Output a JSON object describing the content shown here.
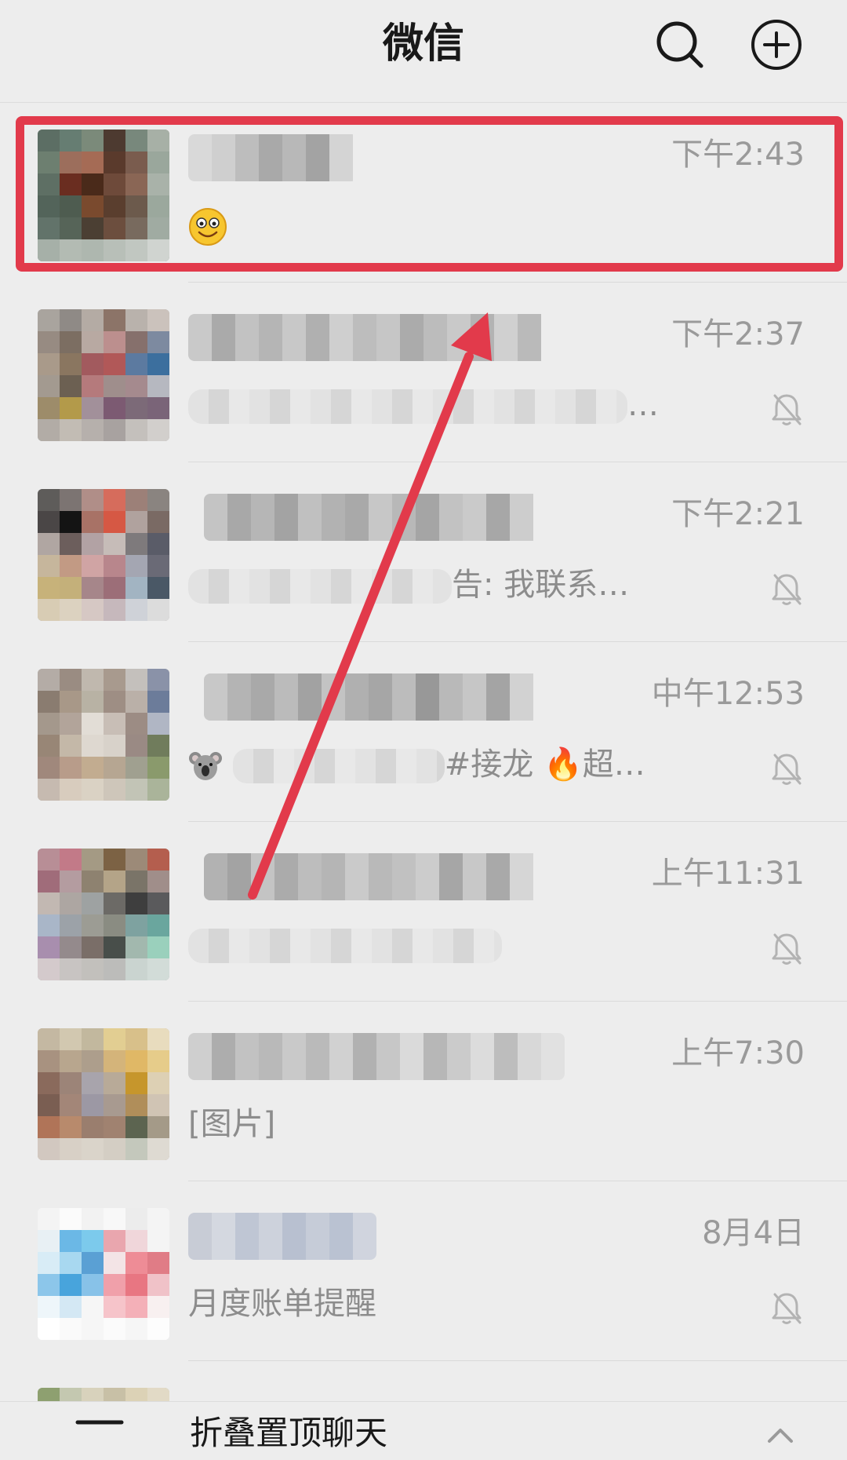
{
  "header": {
    "title": "微信",
    "icons": [
      "search-icon",
      "add-icon"
    ]
  },
  "chats": [
    {
      "time": "下午2:43",
      "preview_text": "",
      "preview_emoji": "smile-emoji",
      "muted": false,
      "highlighted": true
    },
    {
      "time": "下午2:37",
      "preview_text": "…",
      "muted": true
    },
    {
      "time": "下午2:21",
      "preview_text": "告: 我联系…",
      "muted": true
    },
    {
      "time": "中午12:53",
      "preview_text": "#接龙 🔥超…",
      "preview_emoji": "koala-emoji",
      "muted": true
    },
    {
      "time": "上午11:31",
      "preview_text": "",
      "muted": true
    },
    {
      "time": "上午7:30",
      "preview_text": "[图片]",
      "muted": false
    },
    {
      "time": "8月4日",
      "preview_text": "月度账单提醒",
      "muted": true
    }
  ],
  "fold_bar": {
    "label": "折叠置顶聊天"
  },
  "colors": {
    "background": "#ededed",
    "highlight": "#e23a4b",
    "time_text": "#9a9a9a"
  }
}
